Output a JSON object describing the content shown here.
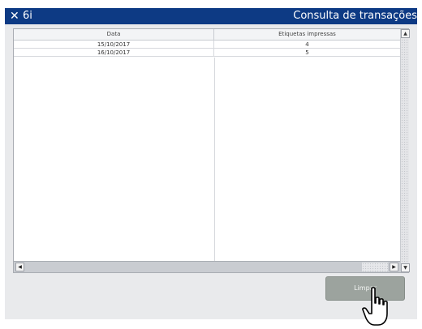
{
  "titlebar": {
    "close_symbol": "✕",
    "app_name": "6i",
    "title": "Consulta de transações"
  },
  "table": {
    "columns": [
      "Data",
      "Etiquetas impressas"
    ],
    "rows": [
      [
        "15/10/2017",
        "4"
      ],
      [
        "16/10/2017",
        "5"
      ]
    ]
  },
  "scrollbars": {
    "up_arrow": "▲",
    "down_arrow": "▼",
    "left_arrow": "◀",
    "right_arrow": "▶"
  },
  "actions": {
    "clear_label": "Limpar"
  },
  "colors": {
    "titlebar": "#0d3a84",
    "content_bg": "#e9eaec",
    "button_bg": "#9ca39e"
  },
  "icons": {
    "close": "close-icon",
    "cursor": "hand-pointer-icon"
  }
}
